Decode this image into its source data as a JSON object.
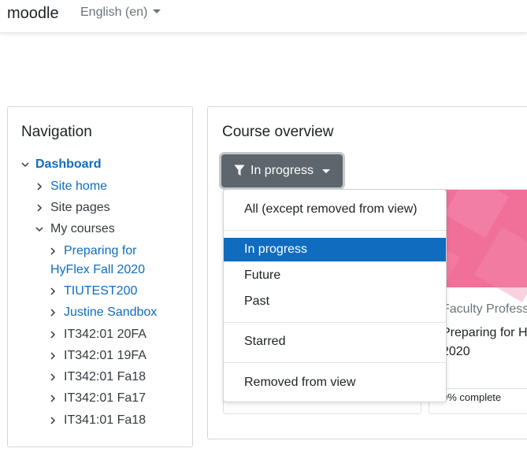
{
  "header": {
    "brand": "moodle",
    "language": "English (en)"
  },
  "navigation": {
    "title": "Navigation",
    "items": [
      {
        "label": "Dashboard",
        "state": "expanded",
        "style": "link-bold"
      },
      {
        "label": "Site home",
        "state": "collapsed",
        "style": "link"
      },
      {
        "label": "Site pages",
        "state": "collapsed",
        "style": "plain"
      },
      {
        "label": "My courses",
        "state": "expanded",
        "style": "plain"
      },
      {
        "label": "Preparing for",
        "label2": "HyFlex Fall 2020",
        "state": "collapsed",
        "style": "link"
      },
      {
        "label": "TIUTEST200",
        "state": "collapsed",
        "style": "link"
      },
      {
        "label": "Justine Sandbox",
        "state": "collapsed",
        "style": "link"
      },
      {
        "label": "IT342:01 20FA",
        "state": "collapsed",
        "style": "plain"
      },
      {
        "label": "IT342:01 19FA",
        "state": "collapsed",
        "style": "plain"
      },
      {
        "label": "IT342:01 Fa18",
        "state": "collapsed",
        "style": "plain"
      },
      {
        "label": "IT342:01 Fa17",
        "state": "collapsed",
        "style": "plain"
      },
      {
        "label": "IT341:01 Fa18",
        "state": "collapsed",
        "style": "plain"
      }
    ]
  },
  "course_overview": {
    "title": "Course overview",
    "filter_label": "In progress",
    "filter_icon": "filter-icon",
    "dropdown": [
      {
        "label": "All (except removed from view)",
        "active": false
      },
      {
        "label": "In progress",
        "active": true
      },
      {
        "label": "Future",
        "active": false
      },
      {
        "label": "Past",
        "active": false
      },
      {
        "label": "Starred",
        "active": false
      },
      {
        "label": "Removed from view",
        "active": false
      }
    ],
    "card": {
      "category": "Faculty Profess",
      "title_line1": "Preparing for H",
      "title_line2": "2020",
      "progress": "0% complete"
    }
  },
  "colors": {
    "link": "#0f6cbf",
    "active_bg": "#0f6cbf",
    "button_bg": "#5e666d",
    "card_image": "#f0709a"
  }
}
